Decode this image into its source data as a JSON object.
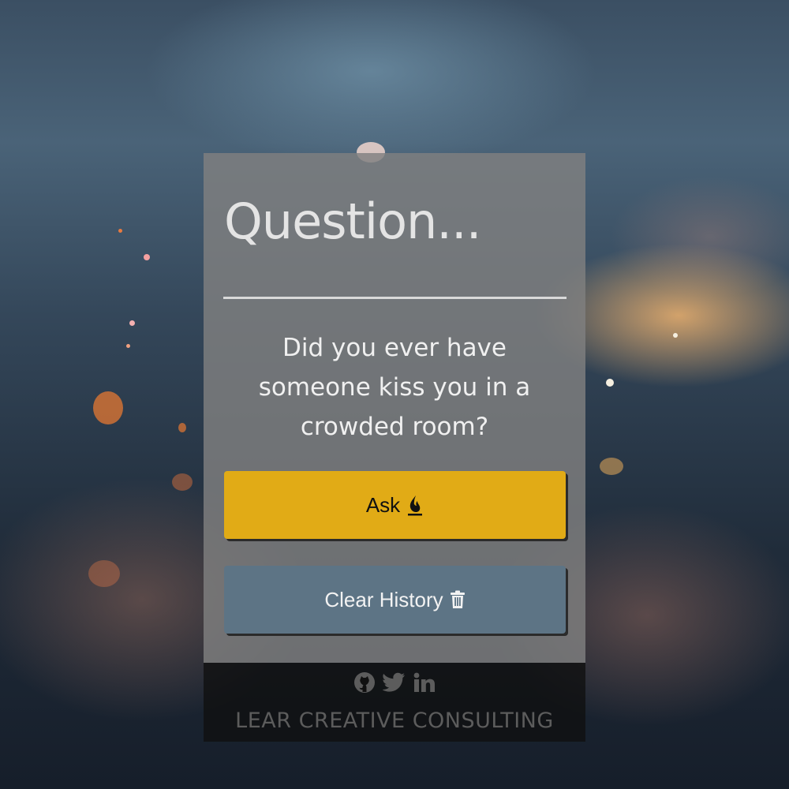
{
  "card": {
    "title": "Question...",
    "question": "Did you ever have someone kiss you in a crowded room?"
  },
  "buttons": {
    "ask_label": "Ask",
    "ask_icon": "flame-icon",
    "clear_label": "Clear History",
    "clear_icon": "trash-icon"
  },
  "footer": {
    "social_icons": [
      "github-icon",
      "twitter-icon",
      "linkedin-icon"
    ],
    "brand": "LEAR CREATIVE CONSULTING"
  },
  "colors": {
    "ask_button": "#e1ab16",
    "clear_button": "#5d7485",
    "card": "#808080",
    "footer": "#101010"
  }
}
